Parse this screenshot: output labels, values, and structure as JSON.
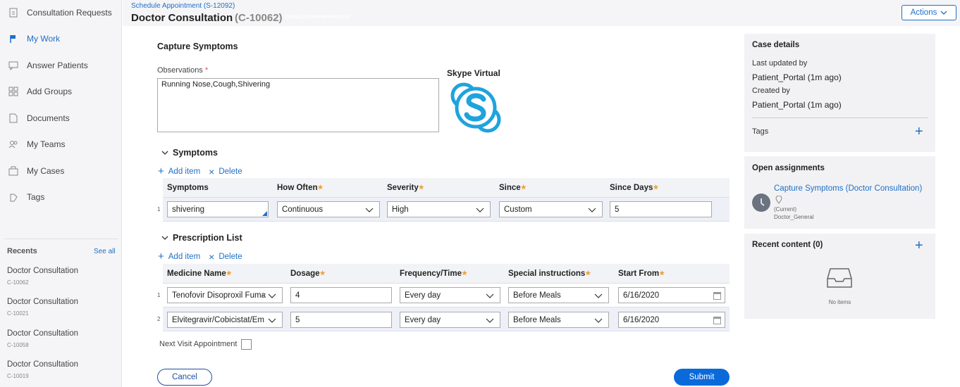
{
  "sidebar": {
    "items": [
      {
        "label": "Consultation Requests",
        "icon": "document-icon"
      },
      {
        "label": "My Work",
        "icon": "flag-icon"
      },
      {
        "label": "Answer Patients",
        "icon": "chat-icon"
      },
      {
        "label": "Add Groups",
        "icon": "grid-icon"
      },
      {
        "label": "Documents",
        "icon": "document-icon"
      },
      {
        "label": "My Teams",
        "icon": "team-icon"
      },
      {
        "label": "My Cases",
        "icon": "cases-icon"
      },
      {
        "label": "Tags",
        "icon": "tag-icon"
      }
    ],
    "recents_title": "Recents",
    "see_all": "See all",
    "recents": [
      {
        "title": "Doctor Consultation",
        "id": "C-10062"
      },
      {
        "title": "Doctor Consultation",
        "id": "C-10021"
      },
      {
        "title": "Doctor Consultation",
        "id": "C-10058"
      },
      {
        "title": "Doctor Consultation",
        "id": "C-10019"
      }
    ]
  },
  "header": {
    "breadcrumb": "Schedule Appointment (S-12092)",
    "title": "Doctor Consultation",
    "case_id": "(C-10062)",
    "status": "CONSULTATION-INPROGRESS",
    "actions_label": "Actions"
  },
  "form": {
    "section_title": "Capture Symptoms",
    "observations_label": "Observations",
    "observations_value": "Running Nose,Cough,Shivering",
    "skype_title": "Skype Virtual",
    "symptoms": {
      "title": "Symptoms",
      "add_item": "Add item",
      "delete": "Delete",
      "columns": [
        "Symptoms",
        "How Often",
        "Severity",
        "Since",
        "Since Days"
      ],
      "rows": [
        {
          "num": "1",
          "symptom": "shivering",
          "how_often": "Continuous",
          "severity": "High",
          "since": "Custom",
          "since_days": "5"
        }
      ]
    },
    "prescriptions": {
      "title": "Prescription List",
      "add_item": "Add item",
      "delete": "Delete",
      "columns": [
        "Medicine Name",
        "Dosage",
        "Frequency/Time",
        "Special instructions",
        "Start From"
      ],
      "rows": [
        {
          "num": "1",
          "medicine": "Tenofovir Disoproxil Fuma",
          "dosage": "4",
          "frequency": "Every day",
          "instructions": "Before Meals",
          "start": "6/16/2020"
        },
        {
          "num": "2",
          "medicine": "Elvitegravir/Cobicistat/Em",
          "dosage": "5",
          "frequency": "Every day",
          "instructions": "Before Meals",
          "start": "6/16/2020"
        }
      ]
    },
    "next_visit_label": "Next Visit Appointment",
    "cancel_label": "Cancel",
    "submit_label": "Submit"
  },
  "case_details": {
    "title": "Case details",
    "last_updated_label": "Last updated by",
    "last_updated_value": "Patient_Portal (1m ago)",
    "created_label": "Created by",
    "created_value": "Patient_Portal (1m ago)",
    "tags_label": "Tags"
  },
  "open_assignments": {
    "title": "Open assignments",
    "link": "Capture Symptoms (Doctor Consultation)",
    "current": "(Current)",
    "assignee": "Doctor_General"
  },
  "recent_content": {
    "title": "Recent content (0)",
    "empty": "No items"
  },
  "colors": {
    "accent": "#1f6fc5",
    "submit": "#0b6ad9",
    "skype": "#1fa3dd"
  }
}
